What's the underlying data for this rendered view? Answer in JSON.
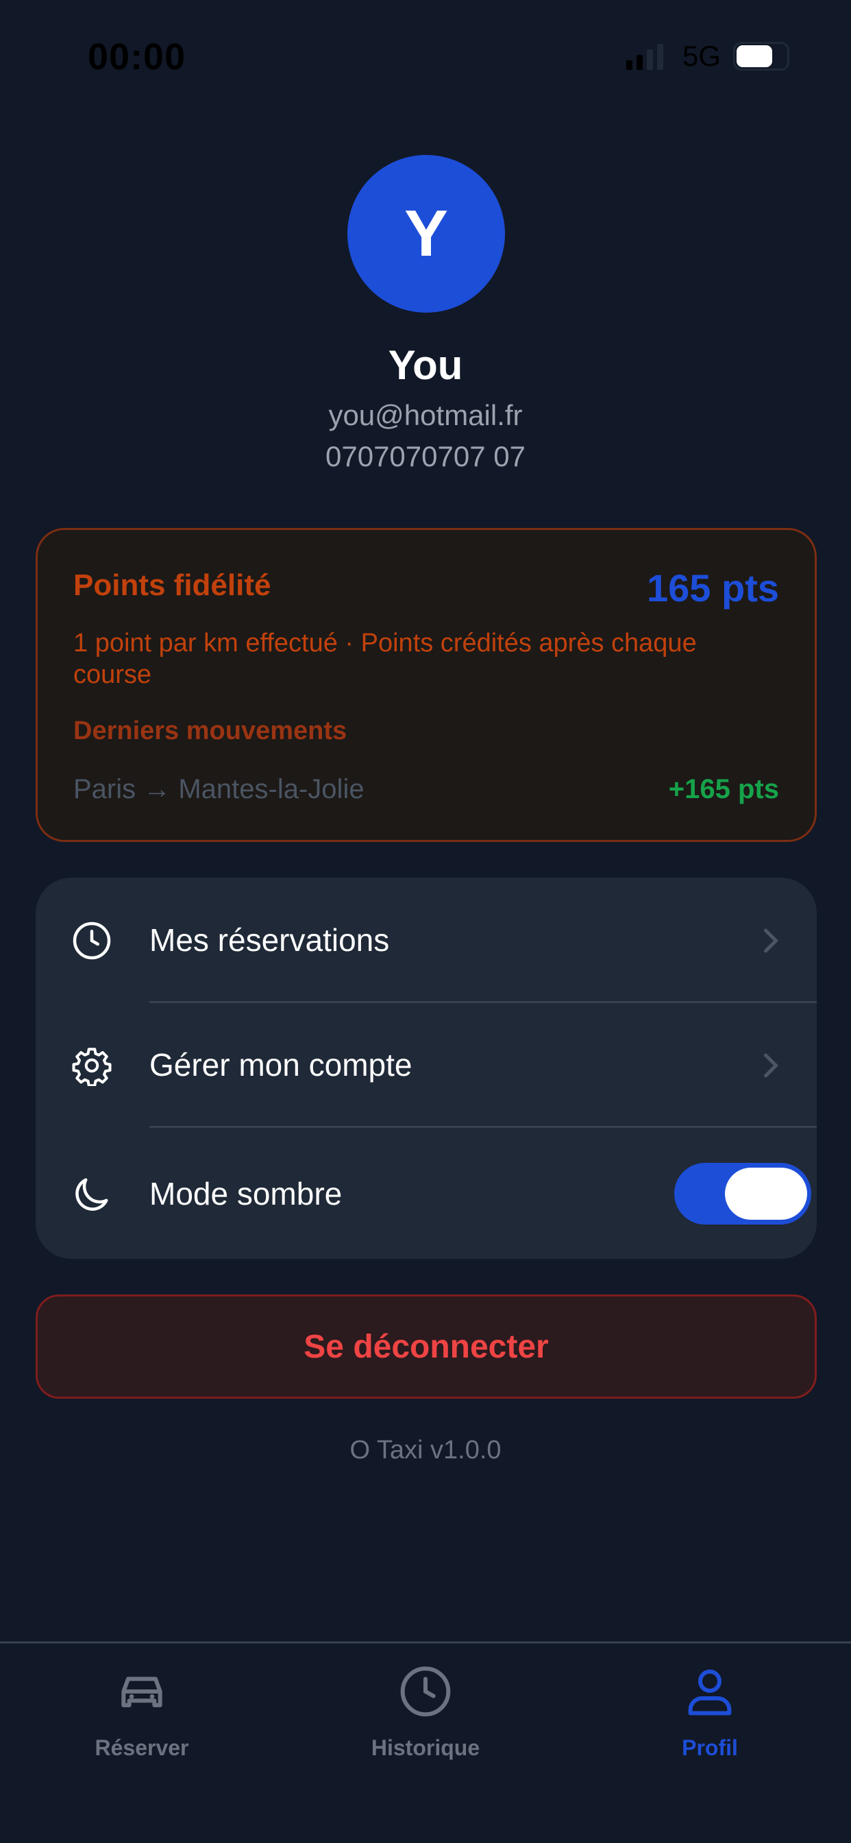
{
  "status_bar": {
    "time": "00:00",
    "network": "5G"
  },
  "profile": {
    "avatar_initial": "Y",
    "name": "You",
    "email": "you@hotmail.fr",
    "phone": "0707070707 07"
  },
  "loyalty": {
    "title": "Points fidélité",
    "points": "165 pts",
    "description": "1 point par km effectué · Points crédités après chaque course",
    "movements_title": "Derniers mouvements",
    "movements": [
      {
        "route": "Paris → Mantes-la-Jolie",
        "points": "+165 pts"
      }
    ]
  },
  "menu": {
    "items": [
      {
        "label": "Mes réservations",
        "icon": "clock-icon"
      },
      {
        "label": "Gérer mon compte",
        "icon": "gear-icon"
      },
      {
        "label": "Mode sombre",
        "icon": "moon-icon",
        "toggle_on": true
      }
    ]
  },
  "logout_label": "Se déconnecter",
  "version": "O Taxi v1.0.0",
  "tabs": [
    {
      "label": "Réserver",
      "icon": "car-icon",
      "active": false
    },
    {
      "label": "Historique",
      "icon": "clock-icon",
      "active": false
    },
    {
      "label": "Profil",
      "icon": "person-icon",
      "active": true
    }
  ],
  "colors": {
    "background": "#111827",
    "accent": "#1d4ed8",
    "loyalty_text": "#c2410c",
    "positive": "#16a34a",
    "danger": "#ef4444"
  }
}
